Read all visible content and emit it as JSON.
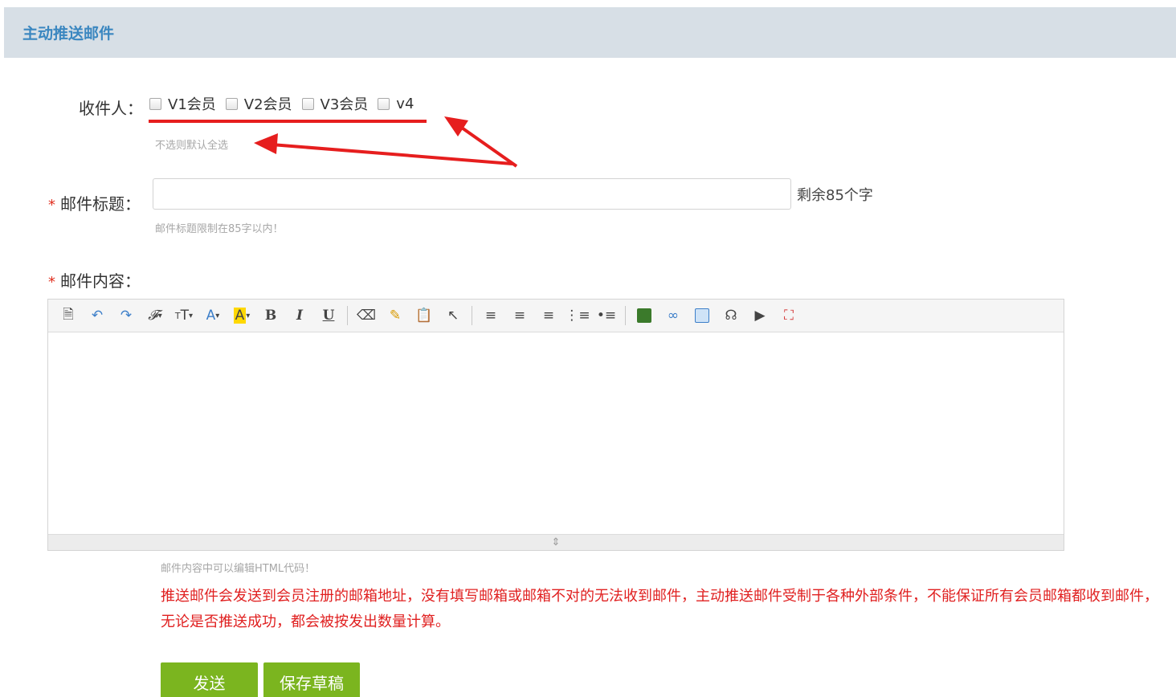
{
  "header": {
    "title": "主动推送邮件"
  },
  "recipients": {
    "label": "收件人：",
    "options": [
      {
        "label": "V1会员"
      },
      {
        "label": "V2会员"
      },
      {
        "label": "V3会员"
      },
      {
        "label": "v4"
      }
    ],
    "hint": "不选则默认全选"
  },
  "subject": {
    "label": "邮件标题：",
    "value": "",
    "placeholder": "",
    "remaining": "剩余85个字",
    "hint": "邮件标题限制在85字以内！"
  },
  "content": {
    "label": "邮件内容：",
    "hint": "邮件内容中可以编辑HTML代码！",
    "notice": "推送邮件会发送到会员注册的邮箱地址，没有填写邮箱或邮箱不对的无法收到邮件，主动推送邮件受制于各种外部条件，不能保证所有会员邮箱都收到邮件，无论是否推送成功，都会被按发出数量计算。"
  },
  "toolbar": {
    "buttons": [
      {
        "icon": "source-code-icon"
      },
      {
        "icon": "undo-icon"
      },
      {
        "icon": "redo-icon"
      },
      {
        "icon": "font-family-icon"
      },
      {
        "icon": "font-size-icon"
      },
      {
        "icon": "font-color-icon"
      },
      {
        "icon": "highlight-color-icon"
      },
      {
        "icon": "bold-icon"
      },
      {
        "icon": "italic-icon"
      },
      {
        "icon": "underline-icon"
      },
      {
        "icon": "eraser-icon"
      },
      {
        "icon": "format-brush-icon"
      },
      {
        "icon": "paste-icon"
      },
      {
        "icon": "select-all-icon"
      },
      {
        "icon": "align-left-icon"
      },
      {
        "icon": "align-center-icon"
      },
      {
        "icon": "align-right-icon"
      },
      {
        "icon": "ordered-list-icon"
      },
      {
        "icon": "unordered-list-icon"
      },
      {
        "icon": "image-icon"
      },
      {
        "icon": "link-icon"
      },
      {
        "icon": "table-icon"
      },
      {
        "icon": "flash-icon"
      },
      {
        "icon": "video-icon"
      },
      {
        "icon": "fullscreen-icon"
      }
    ]
  },
  "actions": {
    "send": "发送",
    "save_draft": "保存草稿"
  },
  "colors": {
    "header_bg": "#d7dfe6",
    "header_title": "#3b87c0",
    "required_star": "#e03020",
    "notice_text": "#e02020",
    "annotation": "#e61e1e",
    "button_bg": "#7bb51f"
  }
}
